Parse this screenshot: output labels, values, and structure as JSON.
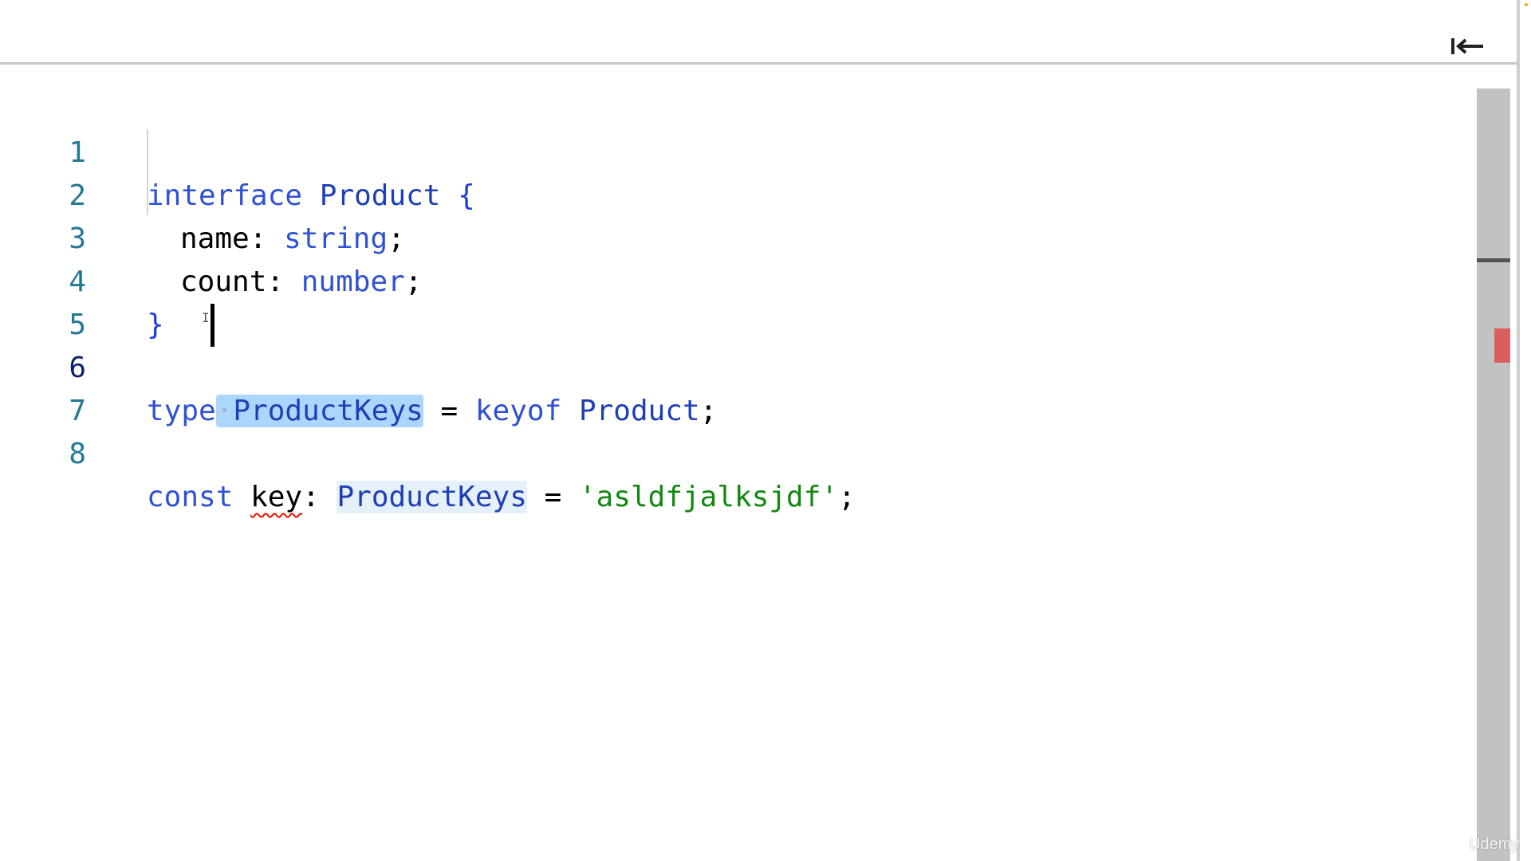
{
  "toolbar": {
    "collapse_icon": "collapse-left-icon"
  },
  "editor": {
    "line_numbers": [
      "1",
      "2",
      "3",
      "4",
      "5",
      "6",
      "7",
      "8"
    ],
    "active_line": "6",
    "lines": {
      "l1": {
        "kw": "interface",
        "type": "Product",
        "brace": "{"
      },
      "l2": {
        "prop": "name",
        "colon": ":",
        "type": "string",
        "semi": ";"
      },
      "l3": {
        "prop": "count",
        "colon": ":",
        "type": "number",
        "semi": ";"
      },
      "l4": {
        "brace": "}"
      },
      "l6": {
        "kw": "type",
        "ws_dot": "·",
        "selected": "ProductKeys",
        "eq": "=",
        "kw2": "keyof",
        "type": "Product",
        "semi": ";"
      },
      "l8": {
        "kw": "const",
        "var": "key",
        "colon": ":",
        "type": "ProductKeys",
        "eq": "=",
        "str": "'asldfjalksjdf'",
        "semi": ";"
      }
    },
    "errors": [
      {
        "line": "8",
        "token": "key",
        "severity": "error"
      }
    ]
  },
  "colors": {
    "keyword": "#2f51d6",
    "string": "#118811",
    "line_number": "#237893",
    "selection": "#add6ff",
    "error": "#e51400",
    "scroll_marker": "#d95f5f"
  },
  "watermark": "Udemy"
}
